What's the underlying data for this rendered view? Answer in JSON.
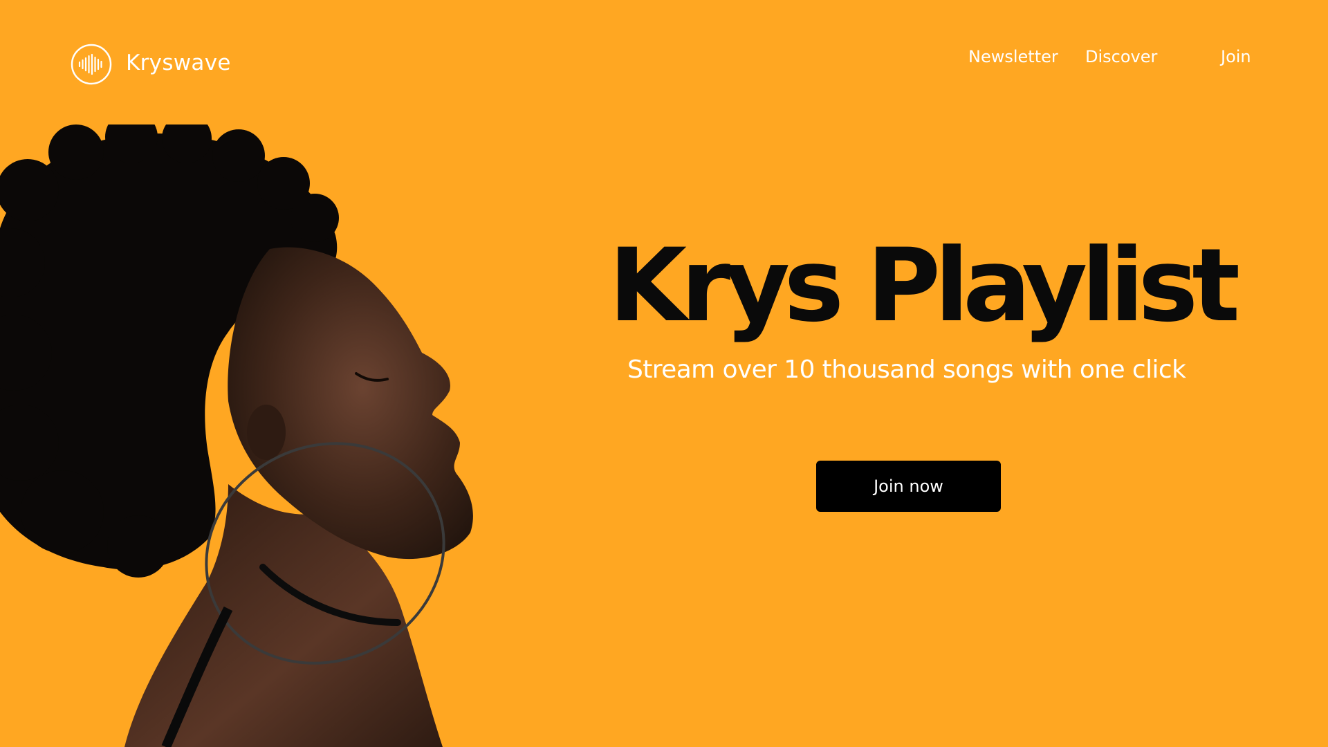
{
  "brand": {
    "name": "Kryswave",
    "logo_icon": "sound-wave-circle-icon"
  },
  "nav": {
    "items": [
      {
        "label": "Newsletter"
      },
      {
        "label": "Discover"
      },
      {
        "label": "Join"
      }
    ]
  },
  "hero": {
    "title": "Krys Playlist",
    "subtitle": "Stream over 10 thousand songs with one click",
    "cta_label": "Join now",
    "image": "woman-profile-photo"
  },
  "colors": {
    "background": "#FFA722",
    "title": "#0A0A0A",
    "text_light": "#FFFFFF",
    "button": "#000000"
  }
}
